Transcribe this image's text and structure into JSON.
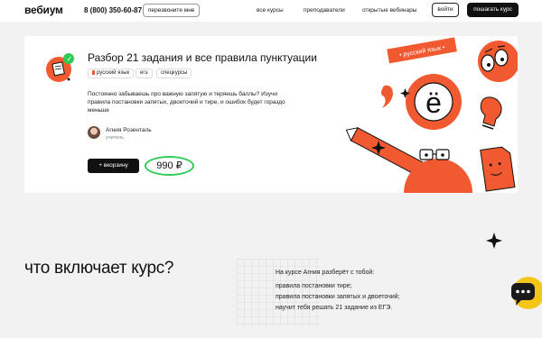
{
  "header": {
    "logo": "вебиум",
    "phone": "8 (800) 350-60-87",
    "callback_label": "перезвоните мне",
    "nav": [
      "все курсы",
      "преподаватели",
      "открытые вебинары"
    ],
    "login_label": "войти",
    "buy_label": "пошагать курс"
  },
  "course": {
    "title": "Разбор 21 задания и все правила пунктуации",
    "tags": [
      "русский язык",
      "егэ",
      "спецкурсы"
    ],
    "description": "Постоянно забываешь про важную запятую и теряешь баллы? Изучи правила постановки запятых, двоеточий и тире, и ошибок будет гораздо меньше",
    "teacher_name": "Агния Розенталь",
    "teacher_role": "учитель",
    "cart_label": "+ вкорзину",
    "price": "990 ₽",
    "illustration_label": "• русский язык •",
    "illustration_letter": "ё",
    "accent_color": "#f15a30",
    "price_circle_color": "#2ecc55"
  },
  "includes": {
    "title": "что включает курс?",
    "intro": "На курсе Агния разберёт с тобой:",
    "items": [
      "правила постановки тире;",
      "правила постановки запятых и двоеточий;",
      "научит тебя решать 21 задание из ЕГЭ."
    ]
  }
}
